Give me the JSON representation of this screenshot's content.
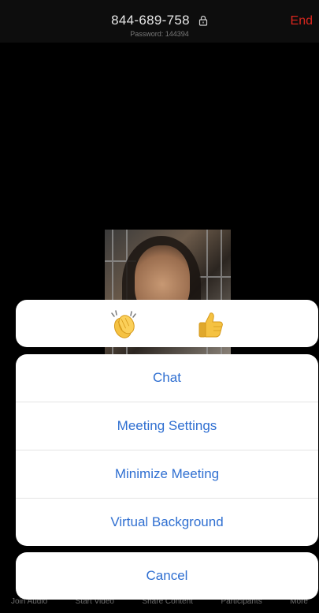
{
  "header": {
    "meeting_id": "844-689-758",
    "password": "Password: 144394",
    "end_label": "End"
  },
  "reactions": [
    {
      "name": "clapping-hands",
      "icon": "clap-icon"
    },
    {
      "name": "thumbs-up",
      "icon": "thumbs-up-icon"
    }
  ],
  "menu": {
    "items": [
      {
        "label": "Chat"
      },
      {
        "label": "Meeting Settings"
      },
      {
        "label": "Minimize Meeting"
      },
      {
        "label": "Virtual Background"
      }
    ],
    "cancel_label": "Cancel"
  },
  "toolbar": {
    "items": [
      {
        "label": "Join Audio"
      },
      {
        "label": "Start Video"
      },
      {
        "label": "Share Content"
      },
      {
        "label": "Participants"
      },
      {
        "label": "More"
      }
    ]
  },
  "colors": {
    "accent": "#2f6fd1",
    "end": "#d7261e",
    "background": "#000000",
    "sheet": "#ffffff"
  }
}
